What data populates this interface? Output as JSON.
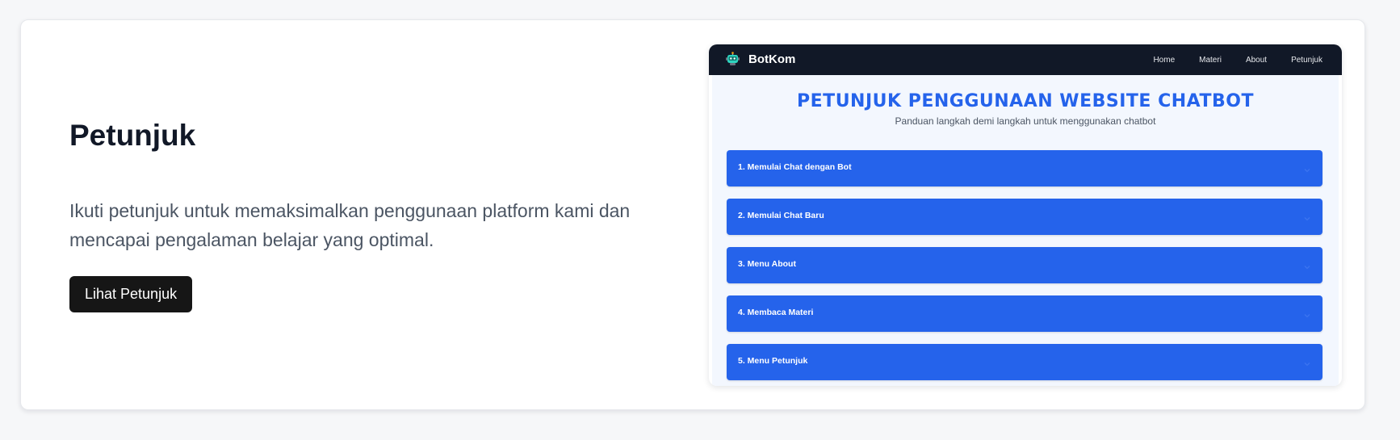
{
  "hero": {
    "title": "Petunjuk",
    "description": "Ikuti petunjuk untuk memaksimalkan penggunaan platform kami dan mencapai pengalaman belajar yang optimal.",
    "button_label": "Lihat Petunjuk"
  },
  "preview": {
    "brand": "BotKom",
    "brand_icon": "robot-icon",
    "nav": [
      "Home",
      "Materi",
      "About",
      "Petunjuk"
    ],
    "title": "PETUNJUK PENGGUNAAN WEBSITE CHATBOT",
    "subtitle": "Panduan langkah demi langkah untuk menggunakan chatbot",
    "accordion": [
      "1. Memulai Chat dengan Bot",
      "2. Memulai Chat Baru",
      "3. Menu About",
      "4. Membaca Materi",
      "5. Menu Petunjuk"
    ],
    "accordion_icon": "chevron-down-icon"
  },
  "colors": {
    "accent": "#2563eb",
    "nav_bg": "#111827",
    "button_bg": "#161616",
    "heading": "#111827",
    "text": "#4b5563"
  }
}
